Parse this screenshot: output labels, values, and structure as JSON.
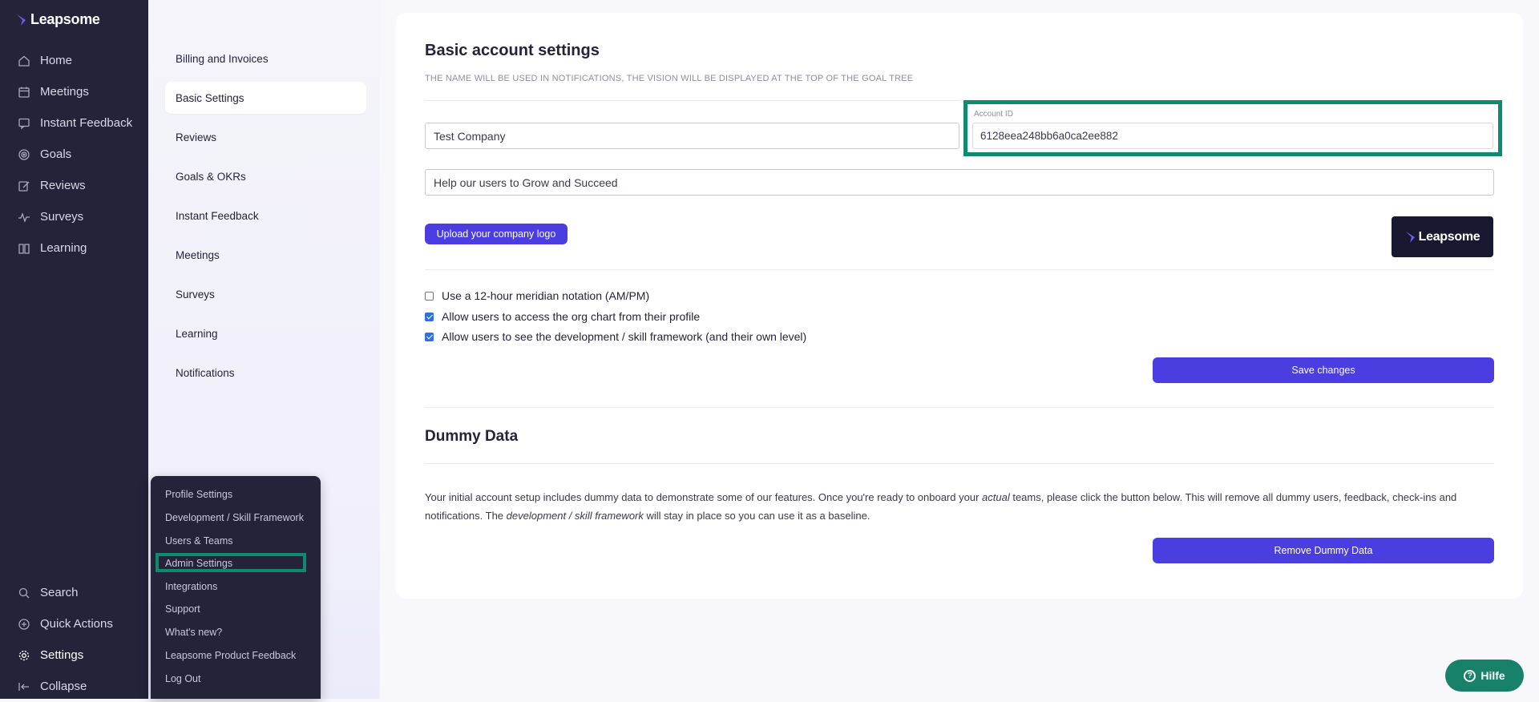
{
  "brand": {
    "name": "Leapsome"
  },
  "sidebar": {
    "items": [
      {
        "label": "Home",
        "icon": "home-icon"
      },
      {
        "label": "Meetings",
        "icon": "calendar-icon"
      },
      {
        "label": "Instant Feedback",
        "icon": "chat-icon"
      },
      {
        "label": "Goals",
        "icon": "target-icon"
      },
      {
        "label": "Reviews",
        "icon": "edit-icon"
      },
      {
        "label": "Surveys",
        "icon": "pulse-icon"
      },
      {
        "label": "Learning",
        "icon": "book-icon"
      }
    ],
    "bottom": [
      {
        "label": "Search",
        "icon": "search-icon"
      },
      {
        "label": "Quick Actions",
        "icon": "plus-circle-icon"
      },
      {
        "label": "Settings",
        "icon": "gear-icon"
      },
      {
        "label": "Collapse",
        "icon": "collapse-icon"
      }
    ]
  },
  "subnav": {
    "items": [
      "Billing and Invoices",
      "Basic Settings",
      "Reviews",
      "Goals & OKRs",
      "Instant Feedback",
      "Meetings",
      "Surveys",
      "Learning",
      "Notifications"
    ],
    "active": "Basic Settings"
  },
  "popup_menu": {
    "items": [
      "Profile Settings",
      "Development / Skill Framework",
      "Users & Teams",
      "Admin Settings",
      "Integrations",
      "Support",
      "What's new?",
      "Leapsome Product Feedback",
      "Log Out"
    ],
    "highlighted": "Admin Settings"
  },
  "basic_settings": {
    "title": "Basic account settings",
    "subtitle": "THE NAME WILL BE USED IN NOTIFICATIONS, THE VISION WILL BE DISPLAYED AT THE TOP OF THE GOAL TREE",
    "company_name": "Test Company",
    "account_id_label": "Account ID",
    "account_id": "6128eea248bb6a0ca2ee882",
    "vision": "Help our users to Grow and Succeed",
    "upload_logo_label": "Upload your company logo",
    "checkboxes": [
      {
        "label": "Use a 12-hour meridian notation (AM/PM)",
        "checked": false
      },
      {
        "label": "Allow users to access the org chart from their profile",
        "checked": true
      },
      {
        "label": "Allow users to see the development / skill framework (and their own level)",
        "checked": true
      }
    ],
    "save_label": "Save changes"
  },
  "dummy_data": {
    "title": "Dummy Data",
    "text_1": "Your initial account setup includes dummy data to demonstrate some of our features. Once you're ready to onboard your ",
    "text_em1": "actual",
    "text_2": " teams, please click the button below. This will remove all dummy users, feedback, check-ins and notifications. The ",
    "text_em2": "development / skill framework",
    "text_3": " will stay in place so you can use it as a baseline.",
    "remove_label": "Remove Dummy Data"
  },
  "help": {
    "label": "Hilfe"
  },
  "colors": {
    "sidebar": "#24233a",
    "accent": "#4b3ee0",
    "highlight": "#0e8a6e",
    "help": "#17816a"
  }
}
